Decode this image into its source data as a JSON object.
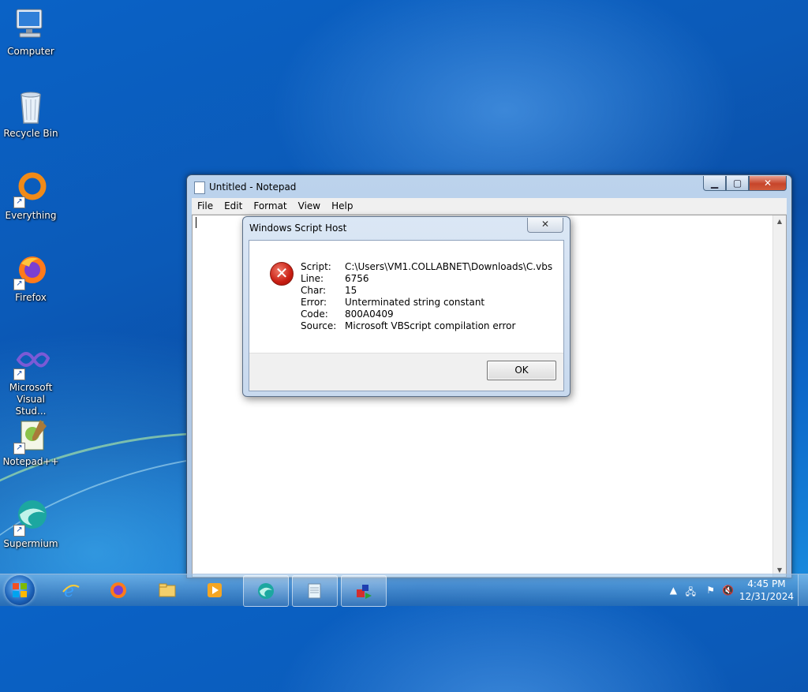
{
  "desktop": {
    "icons": [
      {
        "label": "Computer"
      },
      {
        "label": "Recycle Bin"
      },
      {
        "label": "Everything"
      },
      {
        "label": "Firefox"
      },
      {
        "label": "Microsoft Visual Stud..."
      },
      {
        "label": "Notepad++"
      },
      {
        "label": "Supermium"
      }
    ]
  },
  "notepad": {
    "title": "Untitled - Notepad",
    "menu": [
      "File",
      "Edit",
      "Format",
      "View",
      "Help"
    ],
    "content": ""
  },
  "dialog": {
    "title": "Windows Script Host",
    "close_label": "✕",
    "fields": [
      {
        "label": "Script:",
        "value": "C:\\Users\\VM1.COLLABNET\\Downloads\\C.vbs"
      },
      {
        "label": "Line:",
        "value": "6756"
      },
      {
        "label": "Char:",
        "value": "15"
      },
      {
        "label": "Error:",
        "value": "Unterminated string constant"
      },
      {
        "label": "Code:",
        "value": "800A0409"
      },
      {
        "label": "Source:",
        "value": "Microsoft VBScript compilation error"
      }
    ],
    "ok_label": "OK"
  },
  "taskbar": {
    "pinned": [
      "internet-explorer-icon",
      "firefox-icon",
      "file-explorer-icon",
      "media-player-icon",
      "supermium-icon",
      "notepad-icon",
      "script-host-icon"
    ],
    "clock": {
      "time": "4:45 PM",
      "date": "12/31/2024"
    }
  },
  "colors": {
    "accent": "#0b5ab8",
    "error": "#c81d12"
  }
}
